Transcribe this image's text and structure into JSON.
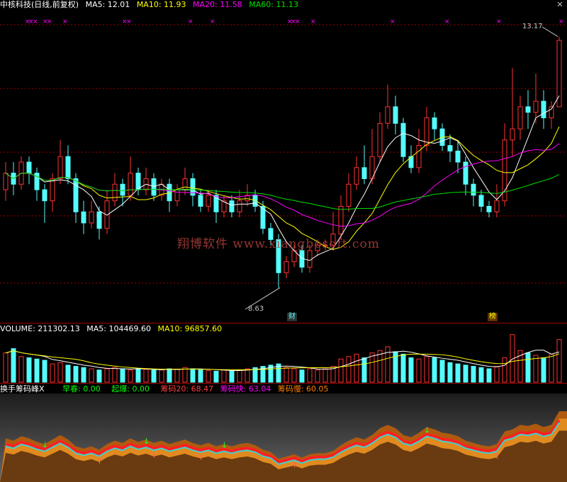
{
  "main_legend": {
    "title": "中核科技(日线,前复权)",
    "ma5": "MA5: 12.01",
    "ma10": "MA10: 11.93",
    "ma20": "MA20: 11.58",
    "ma60": "MA60: 11.13"
  },
  "high_label": "13.17",
  "low_label": "8.63",
  "badge_cai": "财",
  "badge_bang": "榜",
  "watermark": "翔博软件 www.xiangbosoft.com",
  "volume_legend": {
    "title": "VOLUME: 211302.13",
    "ma5": "MA5: 104469.60",
    "ma10": "MA10: 96857.60"
  },
  "indicator_legend": {
    "title": "换手筹码峰X",
    "zaochun": "早春: 0.00",
    "qibao": "起爆: 0.00",
    "chouma20": "筹码20: 68.47",
    "choumakuai": "筹码快: 63.04",
    "choumaman": "筹码慢: 60.05"
  },
  "colors": {
    "up": "#ff3232",
    "down": "#54fcfc",
    "ma5": "#ffffff",
    "ma10": "#ffff00",
    "ma20": "#ff00ff",
    "ma60": "#00e000",
    "grid": "#a00000"
  },
  "chart_data": {
    "type": "candlestick",
    "ylim": [
      8.2,
      13.6
    ],
    "candles": [
      [
        10.4,
        10.7,
        10.2,
        10.9
      ],
      [
        10.7,
        10.5,
        10.3,
        10.9
      ],
      [
        10.5,
        10.9,
        10.4,
        11.0
      ],
      [
        10.9,
        10.7,
        10.5,
        11.0
      ],
      [
        10.7,
        10.4,
        10.2,
        10.8
      ],
      [
        10.4,
        10.2,
        9.8,
        10.5
      ],
      [
        10.2,
        10.6,
        10.0,
        10.7
      ],
      [
        10.6,
        11.0,
        10.5,
        11.3
      ],
      [
        11.0,
        10.6,
        10.5,
        11.2
      ],
      [
        10.6,
        10.0,
        9.8,
        10.7
      ],
      [
        10.0,
        9.8,
        9.6,
        10.2
      ],
      [
        9.8,
        10.0,
        9.7,
        10.2
      ],
      [
        10.0,
        9.7,
        9.5,
        10.1
      ],
      [
        9.7,
        10.2,
        9.6,
        10.4
      ],
      [
        10.2,
        10.5,
        10.1,
        10.7
      ],
      [
        10.5,
        10.3,
        10.1,
        10.6
      ],
      [
        10.3,
        10.7,
        10.2,
        11.0
      ],
      [
        10.7,
        10.4,
        10.3,
        10.8
      ],
      [
        10.4,
        10.6,
        10.3,
        10.8
      ],
      [
        10.6,
        10.3,
        10.2,
        10.7
      ],
      [
        10.3,
        10.5,
        10.2,
        10.6
      ],
      [
        10.5,
        10.2,
        10.0,
        10.6
      ],
      [
        10.2,
        10.4,
        10.1,
        10.5
      ],
      [
        10.4,
        10.6,
        10.3,
        10.8
      ],
      [
        10.6,
        10.3,
        10.1,
        10.7
      ],
      [
        10.3,
        10.1,
        10.0,
        10.4
      ],
      [
        10.1,
        10.3,
        10.0,
        10.4
      ],
      [
        10.3,
        10.0,
        9.8,
        10.4
      ],
      [
        10.0,
        10.2,
        9.9,
        10.3
      ],
      [
        10.2,
        10.0,
        9.9,
        10.3
      ],
      [
        10.0,
        10.2,
        9.9,
        10.4
      ],
      [
        10.2,
        10.3,
        10.1,
        10.5
      ],
      [
        10.3,
        10.1,
        10.0,
        10.4
      ],
      [
        10.1,
        9.7,
        9.6,
        10.2
      ],
      [
        9.7,
        9.5,
        9.4,
        9.8
      ],
      [
        9.5,
        8.9,
        8.63,
        9.6
      ],
      [
        8.9,
        9.1,
        8.8,
        9.2
      ],
      [
        9.1,
        9.3,
        9.0,
        9.4
      ],
      [
        9.3,
        9.0,
        8.9,
        9.4
      ],
      [
        9.0,
        9.3,
        8.9,
        9.4
      ],
      [
        9.3,
        9.4,
        9.2,
        9.5
      ],
      [
        9.4,
        9.4,
        9.3,
        9.5
      ],
      [
        9.4,
        9.6,
        9.3,
        10.0
      ],
      [
        9.6,
        10.1,
        9.5,
        10.3
      ],
      [
        10.1,
        10.5,
        10.0,
        10.7
      ],
      [
        10.5,
        10.8,
        10.4,
        11.0
      ],
      [
        10.8,
        10.6,
        10.5,
        11.2
      ],
      [
        10.6,
        11.0,
        10.5,
        11.5
      ],
      [
        11.0,
        11.6,
        10.9,
        11.8
      ],
      [
        11.6,
        11.9,
        11.5,
        12.3
      ],
      [
        11.9,
        11.6,
        11.4,
        12.1
      ],
      [
        11.6,
        11.0,
        10.9,
        11.7
      ],
      [
        11.0,
        10.8,
        10.7,
        11.2
      ],
      [
        10.8,
        11.2,
        10.7,
        11.5
      ],
      [
        11.2,
        11.7,
        11.1,
        11.9
      ],
      [
        11.7,
        11.5,
        11.3,
        11.8
      ],
      [
        11.5,
        11.2,
        11.1,
        11.6
      ],
      [
        11.2,
        11.1,
        10.9,
        11.4
      ],
      [
        11.1,
        10.9,
        10.7,
        11.3
      ],
      [
        10.9,
        10.5,
        10.3,
        11.0
      ],
      [
        10.5,
        10.3,
        10.1,
        10.6
      ],
      [
        10.3,
        10.1,
        10.0,
        10.4
      ],
      [
        10.1,
        10.0,
        9.9,
        10.2
      ],
      [
        10.0,
        10.2,
        9.9,
        10.5
      ],
      [
        10.2,
        11.3,
        10.1,
        11.6
      ],
      [
        11.3,
        11.5,
        11.0,
        12.6
      ],
      [
        11.5,
        11.9,
        11.3,
        12.1
      ],
      [
        11.9,
        11.8,
        11.5,
        12.2
      ],
      [
        11.8,
        12.0,
        11.6,
        12.5
      ],
      [
        12.0,
        11.7,
        11.5,
        12.2
      ],
      [
        11.7,
        11.9,
        11.5,
        12.0
      ],
      [
        11.9,
        13.1,
        11.9,
        13.17
      ]
    ],
    "volume": [
      48,
      55,
      42,
      40,
      38,
      36,
      30,
      32,
      28,
      26,
      24,
      22,
      20,
      22,
      24,
      22,
      20,
      22,
      21,
      20,
      20,
      22,
      21,
      24,
      22,
      20,
      19,
      18,
      20,
      19,
      20,
      22,
      24,
      26,
      28,
      30,
      24,
      22,
      20,
      22,
      20,
      22,
      26,
      38,
      42,
      46,
      40,
      48,
      52,
      58,
      50,
      46,
      40,
      38,
      42,
      40,
      36,
      32,
      30,
      28,
      26,
      24,
      22,
      26,
      40,
      78,
      52,
      48,
      44,
      40,
      46,
      70
    ],
    "volume_max": 80
  }
}
